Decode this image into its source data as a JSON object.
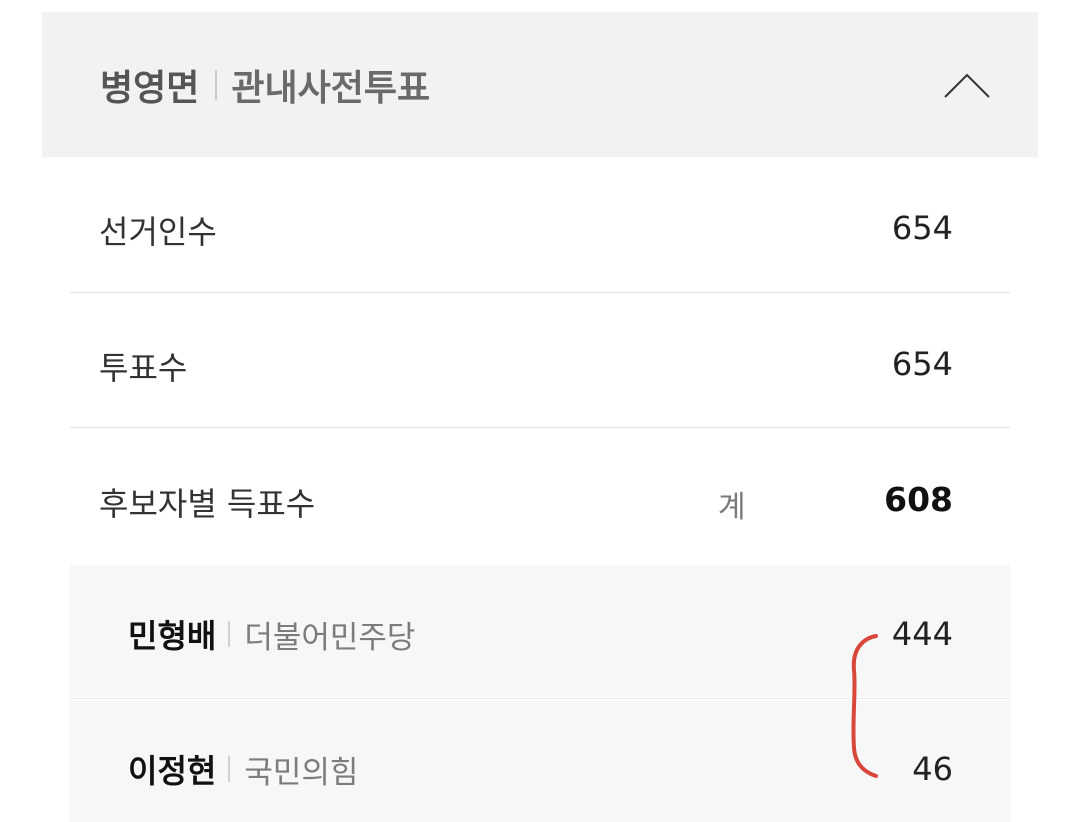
{
  "header": {
    "region": "병영면",
    "category": "관내사전투표"
  },
  "stats": {
    "electors_label": "선거인수",
    "electors_value": "654",
    "votes_label": "투표수",
    "votes_value": "654",
    "candidate_votes_label": "후보자별 득표수",
    "total_label": "계",
    "total_value": "608"
  },
  "candidates": [
    {
      "name": "민형배",
      "party": "더불어민주당",
      "votes": "444"
    },
    {
      "name": "이정현",
      "party": "국민의힘",
      "votes": "46"
    }
  ],
  "colors": {
    "header_bg": "#f2f2f2",
    "candidate_bg": "#f7f7f7",
    "annotation": "#d9473b"
  }
}
